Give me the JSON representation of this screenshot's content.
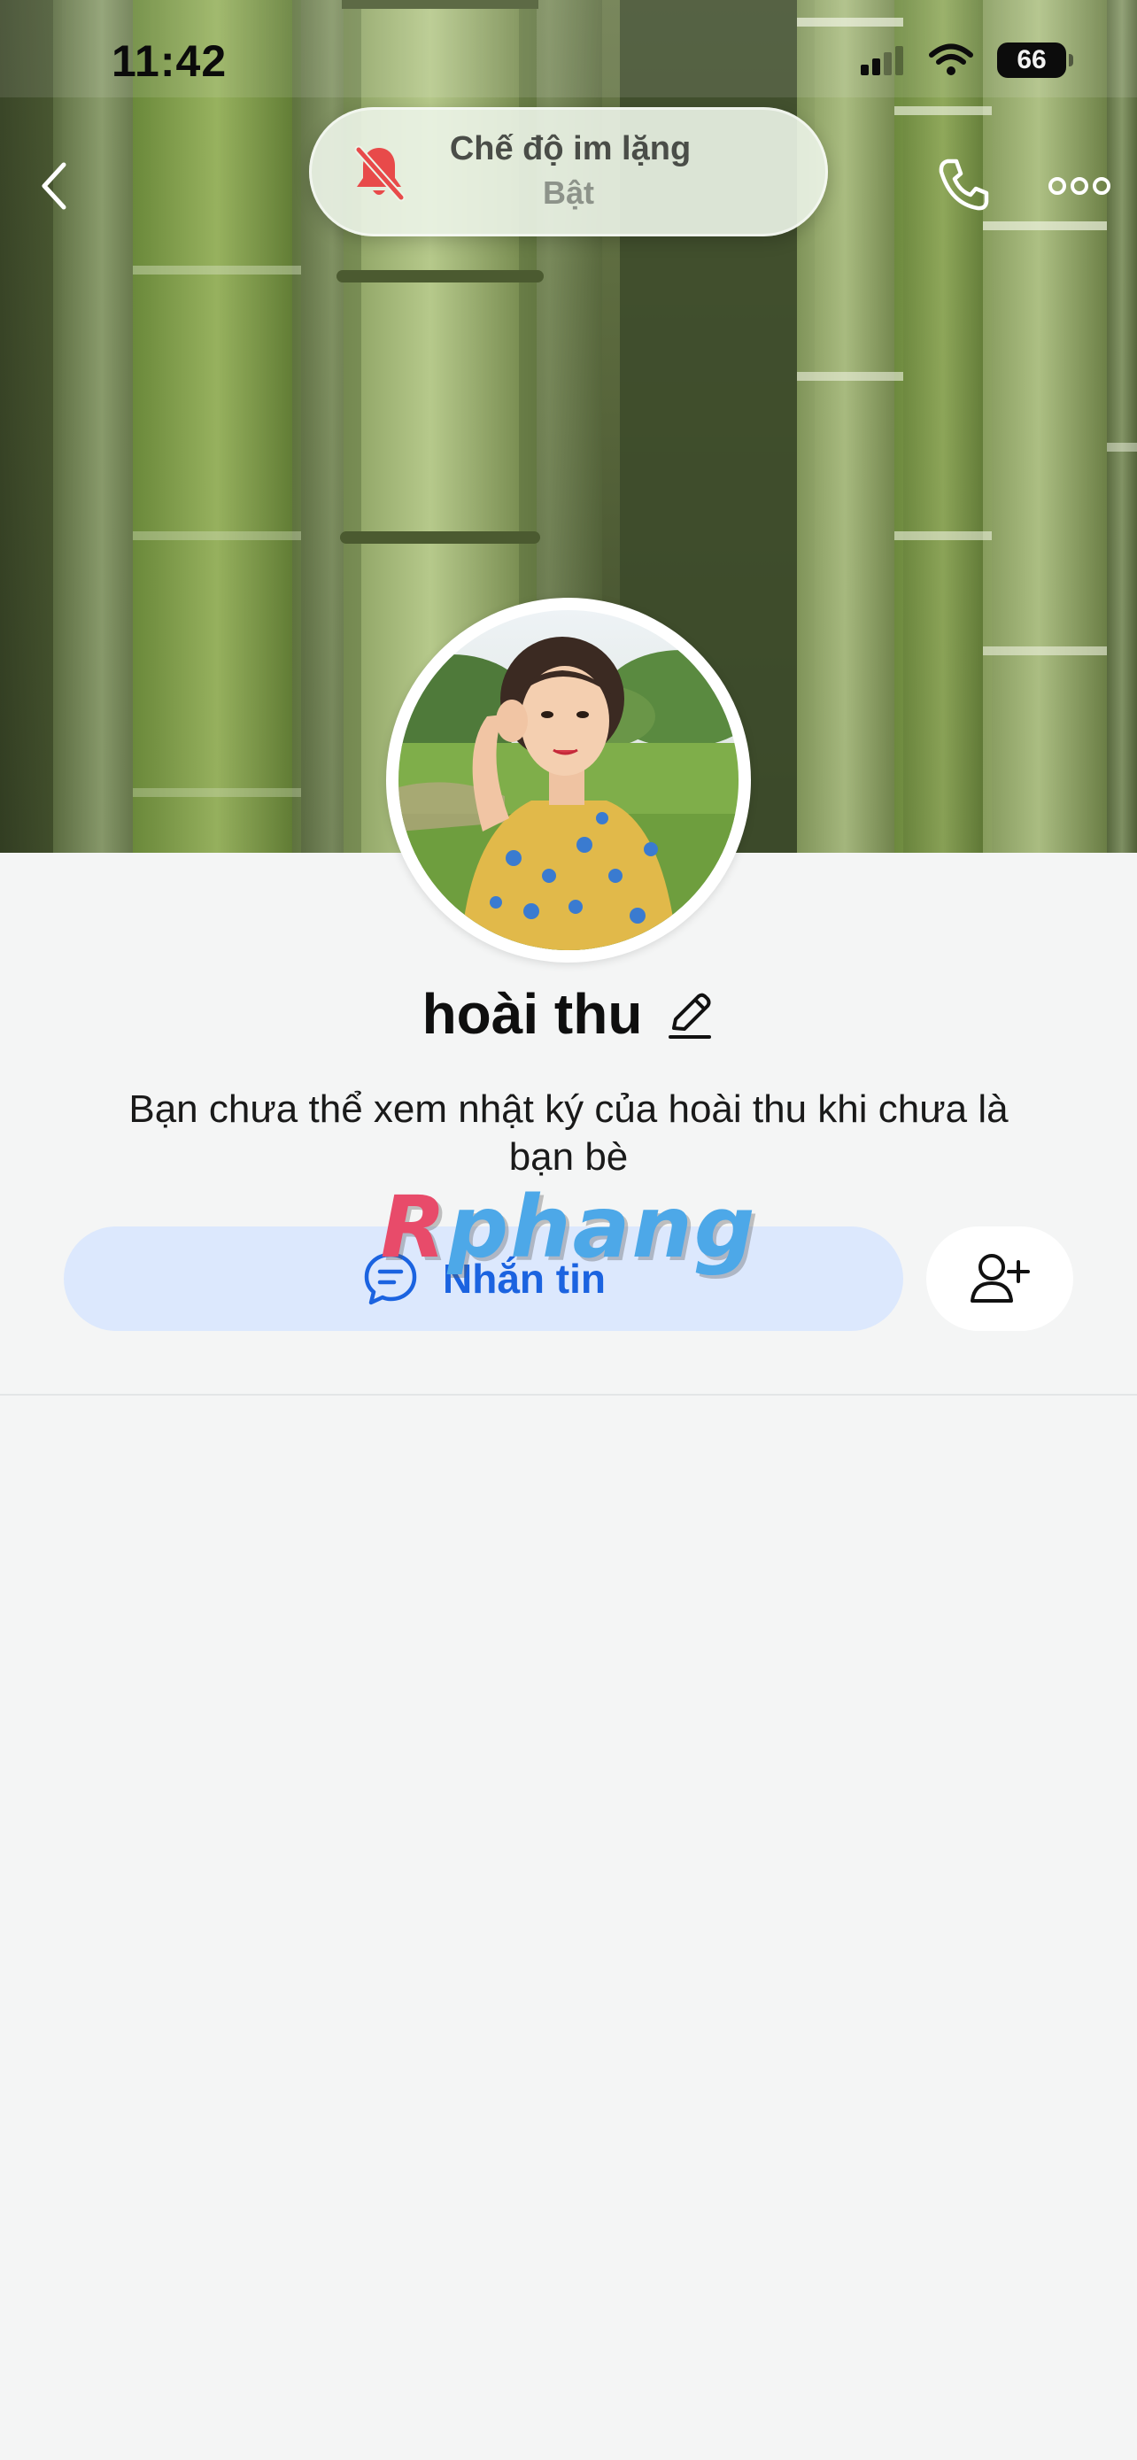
{
  "status_bar": {
    "time": "11:42",
    "battery": "66"
  },
  "header": {
    "back_icon": "chevron-left-icon",
    "call_icon": "phone-icon",
    "more_icon": "more-horizontal-icon"
  },
  "silent_mode": {
    "title": "Chế độ im lặng",
    "state": "Bật",
    "icon": "bell-off-icon",
    "icon_color": "#e84a4a"
  },
  "profile": {
    "name": "hoài thu",
    "notice": "Bạn chưa thể xem nhật ký của hoài thu khi chưa là bạn bè"
  },
  "actions": {
    "message_label": "Nhắn tin",
    "message_icon": "chat-bubble-icon",
    "add_friend_icon": "add-user-icon"
  },
  "watermark": {
    "first": "R",
    "rest": "phang"
  },
  "colors": {
    "accent": "#1b63e0",
    "message_button_bg": "#dce8fd",
    "page_bg": "#f4f5f5"
  }
}
